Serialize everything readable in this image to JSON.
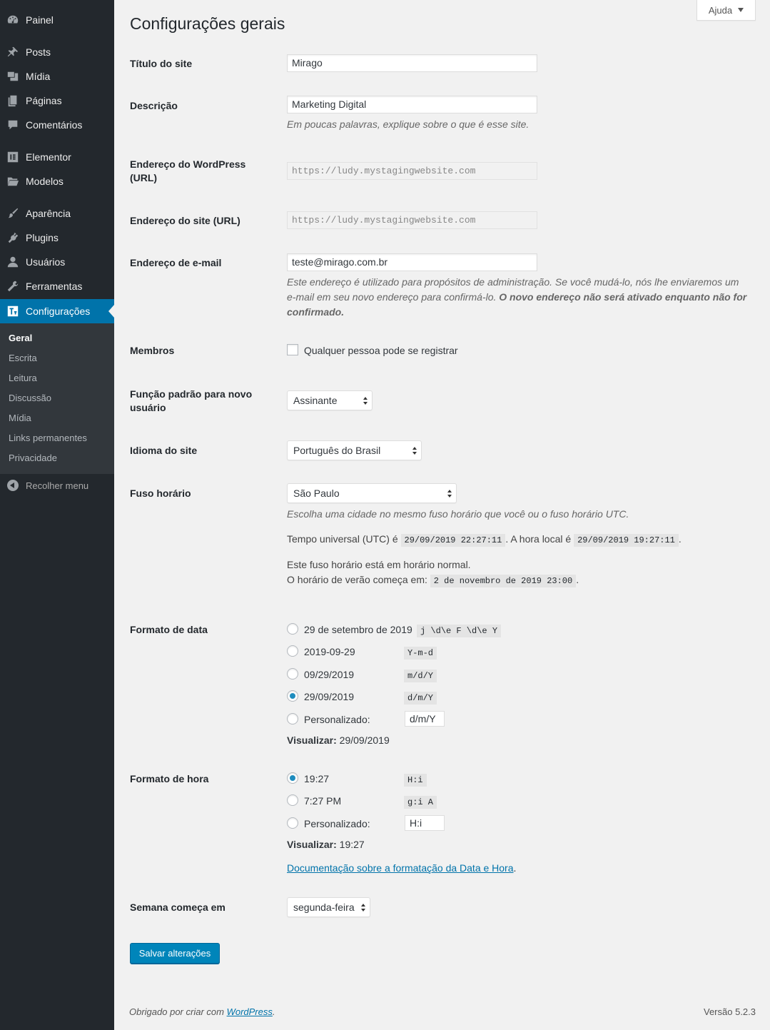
{
  "sidebar": {
    "menu": [
      {
        "label": "Painel",
        "icon": "dashboard-icon"
      },
      {
        "label": "Posts",
        "icon": "pin-icon"
      },
      {
        "label": "Mídia",
        "icon": "media-icon"
      },
      {
        "label": "Páginas",
        "icon": "page-icon"
      },
      {
        "label": "Comentários",
        "icon": "comment-icon"
      },
      {
        "label": "Elementor",
        "icon": "elementor-icon"
      },
      {
        "label": "Modelos",
        "icon": "folder-icon"
      },
      {
        "label": "Aparência",
        "icon": "brush-icon"
      },
      {
        "label": "Plugins",
        "icon": "plugin-icon"
      },
      {
        "label": "Usuários",
        "icon": "user-icon"
      },
      {
        "label": "Ferramentas",
        "icon": "wrench-icon"
      },
      {
        "label": "Configurações",
        "icon": "settings-icon"
      }
    ],
    "submenu": [
      "Geral",
      "Escrita",
      "Leitura",
      "Discussão",
      "Mídia",
      "Links permanentes",
      "Privacidade"
    ],
    "collapse_label": "Recolher menu"
  },
  "help_tab": "Ajuda",
  "page_title": "Configurações gerais",
  "fields": {
    "site_title": {
      "label": "Título do site",
      "value": "Mirago"
    },
    "tagline": {
      "label": "Descrição",
      "value": "Marketing Digital",
      "description": "Em poucas palavras, explique sobre o que é esse site."
    },
    "wp_url": {
      "label": "Endereço do WordPress (URL)",
      "value": "https://ludy.mystagingwebsite.com"
    },
    "site_url": {
      "label": "Endereço do site (URL)",
      "value": "https://ludy.mystagingwebsite.com"
    },
    "email": {
      "label": "Endereço de e-mail",
      "value": "teste@mirago.com.br",
      "description": "Este endereço é utilizado para propósitos de administração. Se você mudá-lo, nós lhe enviaremos um e-mail em seu novo endereço para confirmá-lo.",
      "description_bold": "O novo endereço não será ativado enquanto não for confirmado."
    },
    "membership": {
      "label": "Membros",
      "checkbox_label": "Qualquer pessoa pode se registrar",
      "checked": false
    },
    "default_role": {
      "label": "Função padrão para novo usuário",
      "value": "Assinante"
    },
    "language": {
      "label": "Idioma do site",
      "value": "Português do Brasil"
    },
    "timezone": {
      "label": "Fuso horário",
      "value": "São Paulo",
      "description": "Escolha uma cidade no mesmo fuso horário que você ou o fuso horário UTC.",
      "utc_prefix": "Tempo universal (UTC) é",
      "utc_value": "29/09/2019 22:27:11",
      "local_prefix": ". A hora local é",
      "local_value": "29/09/2019 19:27:11",
      "dst_status": "Este fuso horário está em horário normal.",
      "dst_prefix": "O horário de verão começa em:",
      "dst_value": "2 de novembro de 2019 23:00",
      "period": "."
    },
    "date_format": {
      "label": "Formato de data",
      "options": [
        {
          "label": "29 de setembro de 2019",
          "code": "j \\d\\e F \\d\\e Y",
          "checked": false
        },
        {
          "label": "2019-09-29",
          "code": "Y-m-d",
          "checked": false
        },
        {
          "label": "09/29/2019",
          "code": "m/d/Y",
          "checked": false
        },
        {
          "label": "29/09/2019",
          "code": "d/m/Y",
          "checked": true
        }
      ],
      "custom_label": "Personalizado:",
      "custom_value": "d/m/Y",
      "preview_label": "Visualizar:",
      "preview_value": "29/09/2019"
    },
    "time_format": {
      "label": "Formato de hora",
      "options": [
        {
          "label": "19:27",
          "code": "H:i",
          "checked": true
        },
        {
          "label": "7:27 PM",
          "code": "g:i A",
          "checked": false
        }
      ],
      "custom_label": "Personalizado:",
      "custom_value": "H:i",
      "preview_label": "Visualizar:",
      "preview_value": "19:27",
      "doc_link": "Documentação sobre a formatação da Data e Hora",
      "doc_period": "."
    },
    "week_start": {
      "label": "Semana começa em",
      "value": "segunda-feira"
    }
  },
  "save_button": "Salvar alterações",
  "footer": {
    "thanks": "Obrigado por criar com",
    "link": "WordPress",
    "period": ".",
    "version": "Versão 5.2.3"
  },
  "colors": {
    "sidebar_bg": "#23282d",
    "submenu_bg": "#32373c",
    "accent": "#0073aa",
    "button": "#0085ba",
    "page_bg": "#f1f1f1"
  }
}
